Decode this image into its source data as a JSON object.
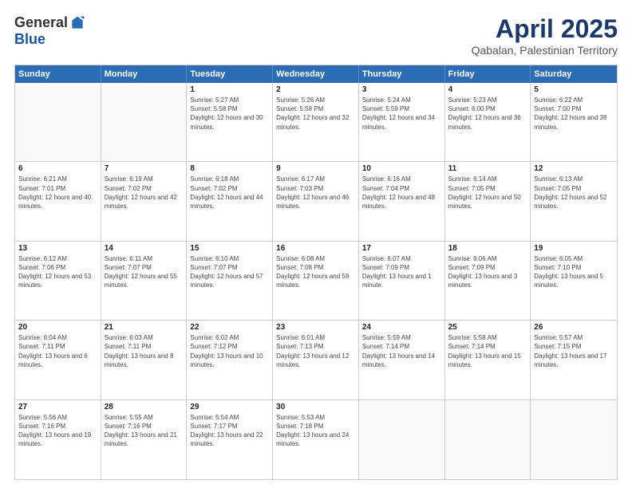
{
  "header": {
    "logo": {
      "general": "General",
      "blue": "Blue"
    },
    "title": "April 2025",
    "location": "Qabalan, Palestinian Territory"
  },
  "days_of_week": [
    "Sunday",
    "Monday",
    "Tuesday",
    "Wednesday",
    "Thursday",
    "Friday",
    "Saturday"
  ],
  "weeks": [
    [
      {
        "day": "",
        "info": ""
      },
      {
        "day": "",
        "info": ""
      },
      {
        "day": "1",
        "sunrise": "Sunrise: 5:27 AM",
        "sunset": "Sunset: 5:58 PM",
        "daylight": "Daylight: 12 hours and 30 minutes."
      },
      {
        "day": "2",
        "sunrise": "Sunrise: 5:26 AM",
        "sunset": "Sunset: 5:58 PM",
        "daylight": "Daylight: 12 hours and 32 minutes."
      },
      {
        "day": "3",
        "sunrise": "Sunrise: 5:24 AM",
        "sunset": "Sunset: 5:59 PM",
        "daylight": "Daylight: 12 hours and 34 minutes."
      },
      {
        "day": "4",
        "sunrise": "Sunrise: 5:23 AM",
        "sunset": "Sunset: 6:00 PM",
        "daylight": "Daylight: 12 hours and 36 minutes."
      },
      {
        "day": "5",
        "sunrise": "Sunrise: 6:22 AM",
        "sunset": "Sunset: 7:00 PM",
        "daylight": "Daylight: 12 hours and 38 minutes."
      }
    ],
    [
      {
        "day": "6",
        "sunrise": "Sunrise: 6:21 AM",
        "sunset": "Sunset: 7:01 PM",
        "daylight": "Daylight: 12 hours and 40 minutes."
      },
      {
        "day": "7",
        "sunrise": "Sunrise: 6:19 AM",
        "sunset": "Sunset: 7:02 PM",
        "daylight": "Daylight: 12 hours and 42 minutes."
      },
      {
        "day": "8",
        "sunrise": "Sunrise: 6:18 AM",
        "sunset": "Sunset: 7:02 PM",
        "daylight": "Daylight: 12 hours and 44 minutes."
      },
      {
        "day": "9",
        "sunrise": "Sunrise: 6:17 AM",
        "sunset": "Sunset: 7:03 PM",
        "daylight": "Daylight: 12 hours and 46 minutes."
      },
      {
        "day": "10",
        "sunrise": "Sunrise: 6:16 AM",
        "sunset": "Sunset: 7:04 PM",
        "daylight": "Daylight: 12 hours and 48 minutes."
      },
      {
        "day": "11",
        "sunrise": "Sunrise: 6:14 AM",
        "sunset": "Sunset: 7:05 PM",
        "daylight": "Daylight: 12 hours and 50 minutes."
      },
      {
        "day": "12",
        "sunrise": "Sunrise: 6:13 AM",
        "sunset": "Sunset: 7:05 PM",
        "daylight": "Daylight: 12 hours and 52 minutes."
      }
    ],
    [
      {
        "day": "13",
        "sunrise": "Sunrise: 6:12 AM",
        "sunset": "Sunset: 7:06 PM",
        "daylight": "Daylight: 12 hours and 53 minutes."
      },
      {
        "day": "14",
        "sunrise": "Sunrise: 6:11 AM",
        "sunset": "Sunset: 7:07 PM",
        "daylight": "Daylight: 12 hours and 55 minutes."
      },
      {
        "day": "15",
        "sunrise": "Sunrise: 6:10 AM",
        "sunset": "Sunset: 7:07 PM",
        "daylight": "Daylight: 12 hours and 57 minutes."
      },
      {
        "day": "16",
        "sunrise": "Sunrise: 6:08 AM",
        "sunset": "Sunset: 7:08 PM",
        "daylight": "Daylight: 12 hours and 59 minutes."
      },
      {
        "day": "17",
        "sunrise": "Sunrise: 6:07 AM",
        "sunset": "Sunset: 7:09 PM",
        "daylight": "Daylight: 13 hours and 1 minute."
      },
      {
        "day": "18",
        "sunrise": "Sunrise: 6:06 AM",
        "sunset": "Sunset: 7:09 PM",
        "daylight": "Daylight: 13 hours and 3 minutes."
      },
      {
        "day": "19",
        "sunrise": "Sunrise: 6:05 AM",
        "sunset": "Sunset: 7:10 PM",
        "daylight": "Daylight: 13 hours and 5 minutes."
      }
    ],
    [
      {
        "day": "20",
        "sunrise": "Sunrise: 6:04 AM",
        "sunset": "Sunset: 7:11 PM",
        "daylight": "Daylight: 13 hours and 6 minutes."
      },
      {
        "day": "21",
        "sunrise": "Sunrise: 6:03 AM",
        "sunset": "Sunset: 7:11 PM",
        "daylight": "Daylight: 13 hours and 8 minutes."
      },
      {
        "day": "22",
        "sunrise": "Sunrise: 6:02 AM",
        "sunset": "Sunset: 7:12 PM",
        "daylight": "Daylight: 13 hours and 10 minutes."
      },
      {
        "day": "23",
        "sunrise": "Sunrise: 6:01 AM",
        "sunset": "Sunset: 7:13 PM",
        "daylight": "Daylight: 13 hours and 12 minutes."
      },
      {
        "day": "24",
        "sunrise": "Sunrise: 5:59 AM",
        "sunset": "Sunset: 7:14 PM",
        "daylight": "Daylight: 13 hours and 14 minutes."
      },
      {
        "day": "25",
        "sunrise": "Sunrise: 5:58 AM",
        "sunset": "Sunset: 7:14 PM",
        "daylight": "Daylight: 13 hours and 15 minutes."
      },
      {
        "day": "26",
        "sunrise": "Sunrise: 5:57 AM",
        "sunset": "Sunset: 7:15 PM",
        "daylight": "Daylight: 13 hours and 17 minutes."
      }
    ],
    [
      {
        "day": "27",
        "sunrise": "Sunrise: 5:56 AM",
        "sunset": "Sunset: 7:16 PM",
        "daylight": "Daylight: 13 hours and 19 minutes."
      },
      {
        "day": "28",
        "sunrise": "Sunrise: 5:55 AM",
        "sunset": "Sunset: 7:16 PM",
        "daylight": "Daylight: 13 hours and 21 minutes."
      },
      {
        "day": "29",
        "sunrise": "Sunrise: 5:54 AM",
        "sunset": "Sunset: 7:17 PM",
        "daylight": "Daylight: 13 hours and 22 minutes."
      },
      {
        "day": "30",
        "sunrise": "Sunrise: 5:53 AM",
        "sunset": "Sunset: 7:18 PM",
        "daylight": "Daylight: 13 hours and 24 minutes."
      },
      {
        "day": "",
        "info": ""
      },
      {
        "day": "",
        "info": ""
      },
      {
        "day": "",
        "info": ""
      }
    ]
  ]
}
